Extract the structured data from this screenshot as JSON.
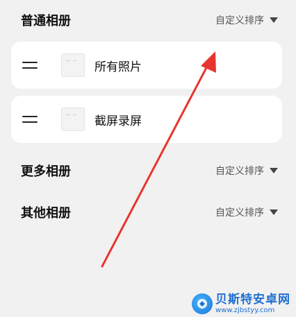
{
  "sections": {
    "normal": {
      "title": "普通相册",
      "sort_label": "自定义排序"
    },
    "more": {
      "title": "更多相册",
      "sort_label": "自定义排序"
    },
    "other": {
      "title": "其他相册",
      "sort_label": "自定义排序"
    }
  },
  "albums": [
    {
      "name": "所有照片"
    },
    {
      "name": "截屏录屏"
    }
  ],
  "watermark": {
    "name": "贝斯特安卓网",
    "url": "www.zjbstyy.com"
  },
  "colors": {
    "background": "#f1f1f1",
    "card": "#ffffff",
    "annotation_arrow": "#e8342e",
    "watermark_blue": "#1f6fd1"
  }
}
